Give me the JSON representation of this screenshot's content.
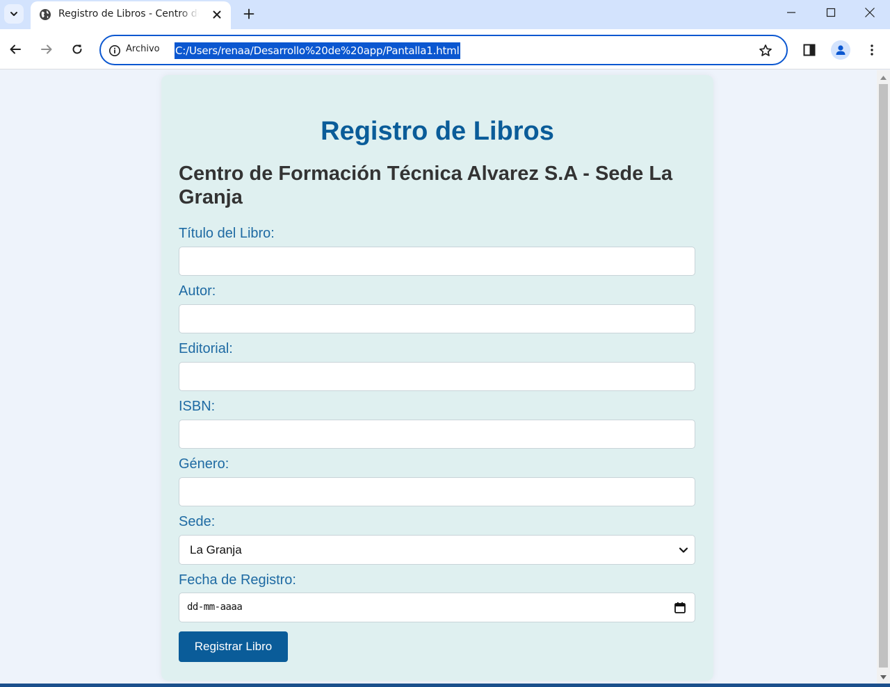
{
  "browser": {
    "tab_title": "Registro de Libros - Centro de Formación Técnica Alvarez S.A",
    "origin_chip": "Archivo",
    "url": "C:/Users/renaa/Desarrollo%20de%20app/Pantalla1.html"
  },
  "page": {
    "title": "Registro de Libros",
    "subtitle": "Centro de Formación Técnica Alvarez S.A - Sede La Granja"
  },
  "form": {
    "titulo_label": "Título del Libro:",
    "titulo_value": "",
    "autor_label": "Autor:",
    "autor_value": "",
    "editorial_label": "Editorial:",
    "editorial_value": "",
    "isbn_label": "ISBN:",
    "isbn_value": "",
    "genero_label": "Género:",
    "genero_value": "",
    "sede_label": "Sede:",
    "sede_selected": "La Granja",
    "fecha_label": "Fecha de Registro:",
    "fecha_placeholder": "dd-mm-aaaa",
    "submit_label": "Registrar Libro"
  },
  "colors": {
    "accent": "#0a5c99",
    "label": "#1e6aa3",
    "card_bg": "#dff0f0",
    "page_bg": "#eef3fb"
  }
}
